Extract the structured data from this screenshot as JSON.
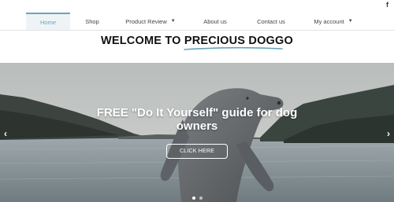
{
  "social": {
    "facebook_glyph": "f"
  },
  "nav": {
    "items": [
      {
        "label": "Home",
        "active": true
      },
      {
        "label": "Shop"
      },
      {
        "label": "Product Review",
        "dropdown": true
      },
      {
        "label": "About us"
      },
      {
        "label": "Contact us"
      },
      {
        "label": "My account",
        "dropdown": true
      }
    ],
    "caret": "▼"
  },
  "welcome": {
    "prefix": "WELCOME TO ",
    "highlight": "PRECIOUS DOGGO"
  },
  "hero": {
    "title": "FREE \"Do It Yourself\" guide for dog owners",
    "cta_label": "CLICK HERE",
    "prev_glyph": "‹",
    "next_glyph": "›"
  },
  "colors": {
    "accent": "#6ba4b6",
    "text": "#111111"
  }
}
